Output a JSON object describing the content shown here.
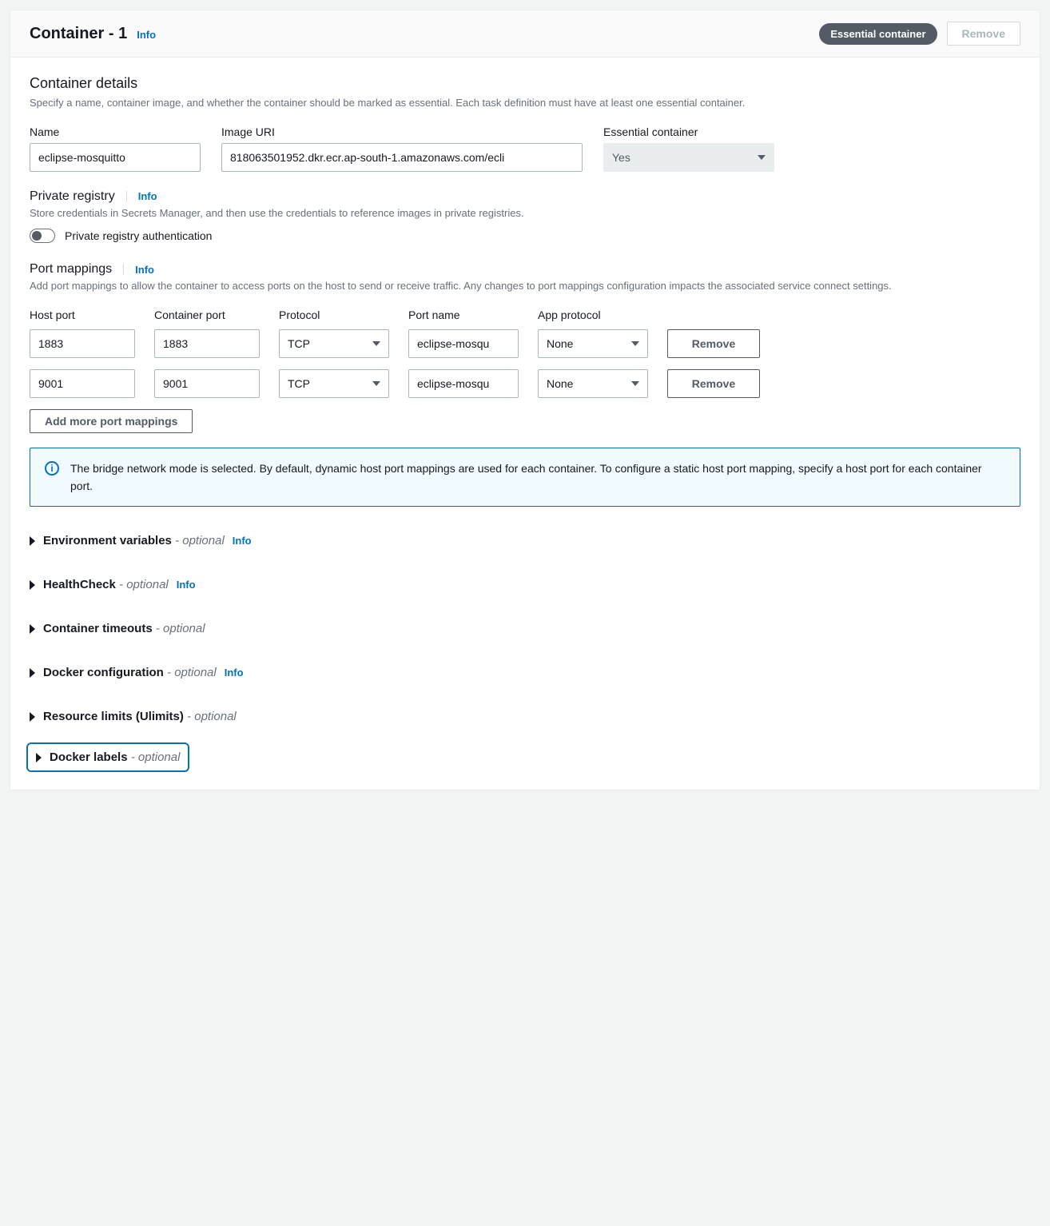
{
  "header": {
    "title": "Container - 1",
    "info": "Info",
    "badge": "Essential container",
    "remove": "Remove"
  },
  "details": {
    "title": "Container details",
    "desc": "Specify a name, container image, and whether the container should be marked as essential. Each task definition must have at least one essential container.",
    "name_label": "Name",
    "name_value": "eclipse-mosquitto",
    "image_label": "Image URI",
    "image_value": "818063501952.dkr.ecr.ap-south-1.amazonaws.com/ecli",
    "essential_label": "Essential container",
    "essential_value": "Yes"
  },
  "private_registry": {
    "title": "Private registry",
    "info": "Info",
    "desc": "Store credentials in Secrets Manager, and then use the credentials to reference images in private registries.",
    "toggle_label": "Private registry authentication"
  },
  "port_mappings": {
    "title": "Port mappings",
    "info": "Info",
    "desc": "Add port mappings to allow the container to access ports on the host to send or receive traffic. Any changes to port mappings configuration impacts the associated service connect settings.",
    "headers": {
      "host": "Host port",
      "container": "Container port",
      "protocol": "Protocol",
      "portname": "Port name",
      "app": "App protocol"
    },
    "rows": [
      {
        "host": "1883",
        "container": "1883",
        "protocol": "TCP",
        "portname": "eclipse-mosqu",
        "app": "None",
        "remove": "Remove"
      },
      {
        "host": "9001",
        "container": "9001",
        "protocol": "TCP",
        "portname": "eclipse-mosqu",
        "app": "None",
        "remove": "Remove"
      }
    ],
    "add": "Add more port mappings",
    "alert": "The bridge network mode is selected. By default, dynamic host port mappings are used for each container. To configure a static host port mapping, specify a host port for each container port."
  },
  "expands": {
    "env": "Environment variables",
    "env_opt": " - optional",
    "env_info": "Info",
    "health": "HealthCheck",
    "health_opt": " - optional",
    "health_info": "Info",
    "timeouts": "Container timeouts",
    "timeouts_opt": " - optional",
    "docker": "Docker configuration",
    "docker_opt": " - optional",
    "docker_info": "Info",
    "ulimits": "Resource limits (Ulimits)",
    "ulimits_opt": " - optional",
    "labels": "Docker labels",
    "labels_opt": " - optional"
  }
}
